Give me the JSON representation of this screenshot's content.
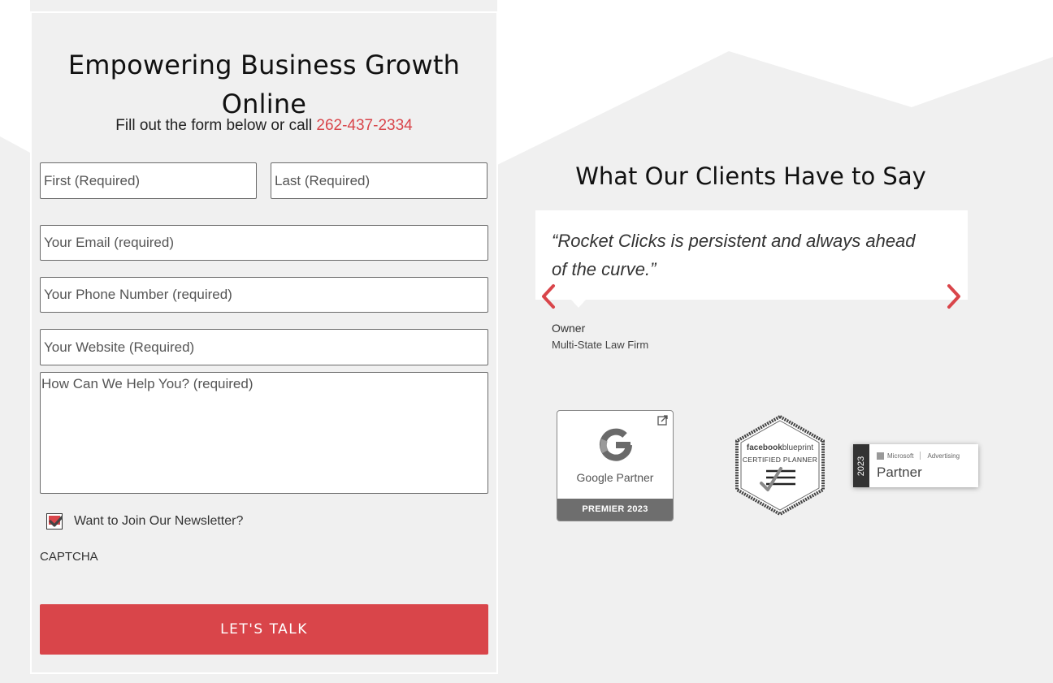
{
  "form": {
    "title": "Empowering Business Growth Online",
    "subtitle_prefix": "Fill out the form below or call",
    "phone": "262-437-2334",
    "fields": {
      "first": {
        "placeholder": "First (Required)",
        "value": ""
      },
      "last": {
        "placeholder": "Last (Required)",
        "value": ""
      },
      "email": {
        "placeholder": "Your Email (required)",
        "value": ""
      },
      "phone": {
        "placeholder": "Your Phone Number (required)",
        "value": ""
      },
      "website": {
        "placeholder": "Your Website (Required)",
        "value": ""
      },
      "help": {
        "placeholder": "How Can We Help You? (required)",
        "value": ""
      }
    },
    "newsletter": {
      "label": "Want to Join Our Newsletter?",
      "checked": true
    },
    "captcha_label": "CAPTCHA",
    "submit_label": "LET'S TALK"
  },
  "testimonials": {
    "title": "What Our Clients Have to Say",
    "current": {
      "quote": "“Rocket Clicks is persistent and always ahead of the curve.”",
      "author_role": "Owner",
      "author_company": "Multi-State Law Firm"
    },
    "prev_icon": "chevron-left-icon",
    "next_icon": "chevron-right-icon"
  },
  "badges": {
    "google": {
      "label": "Google Partner",
      "tier": "PREMIER 2023"
    },
    "facebook": {
      "brand": "facebook",
      "brand_suffix": "blueprint",
      "title": "CERTIFIED PLANNER"
    },
    "microsoft": {
      "year": "2023",
      "brand": "Microsoft",
      "division": "Advertising",
      "label": "Partner"
    }
  },
  "colors": {
    "accent": "#d9454a",
    "background": "#f0f0f0",
    "white": "#ffffff"
  }
}
